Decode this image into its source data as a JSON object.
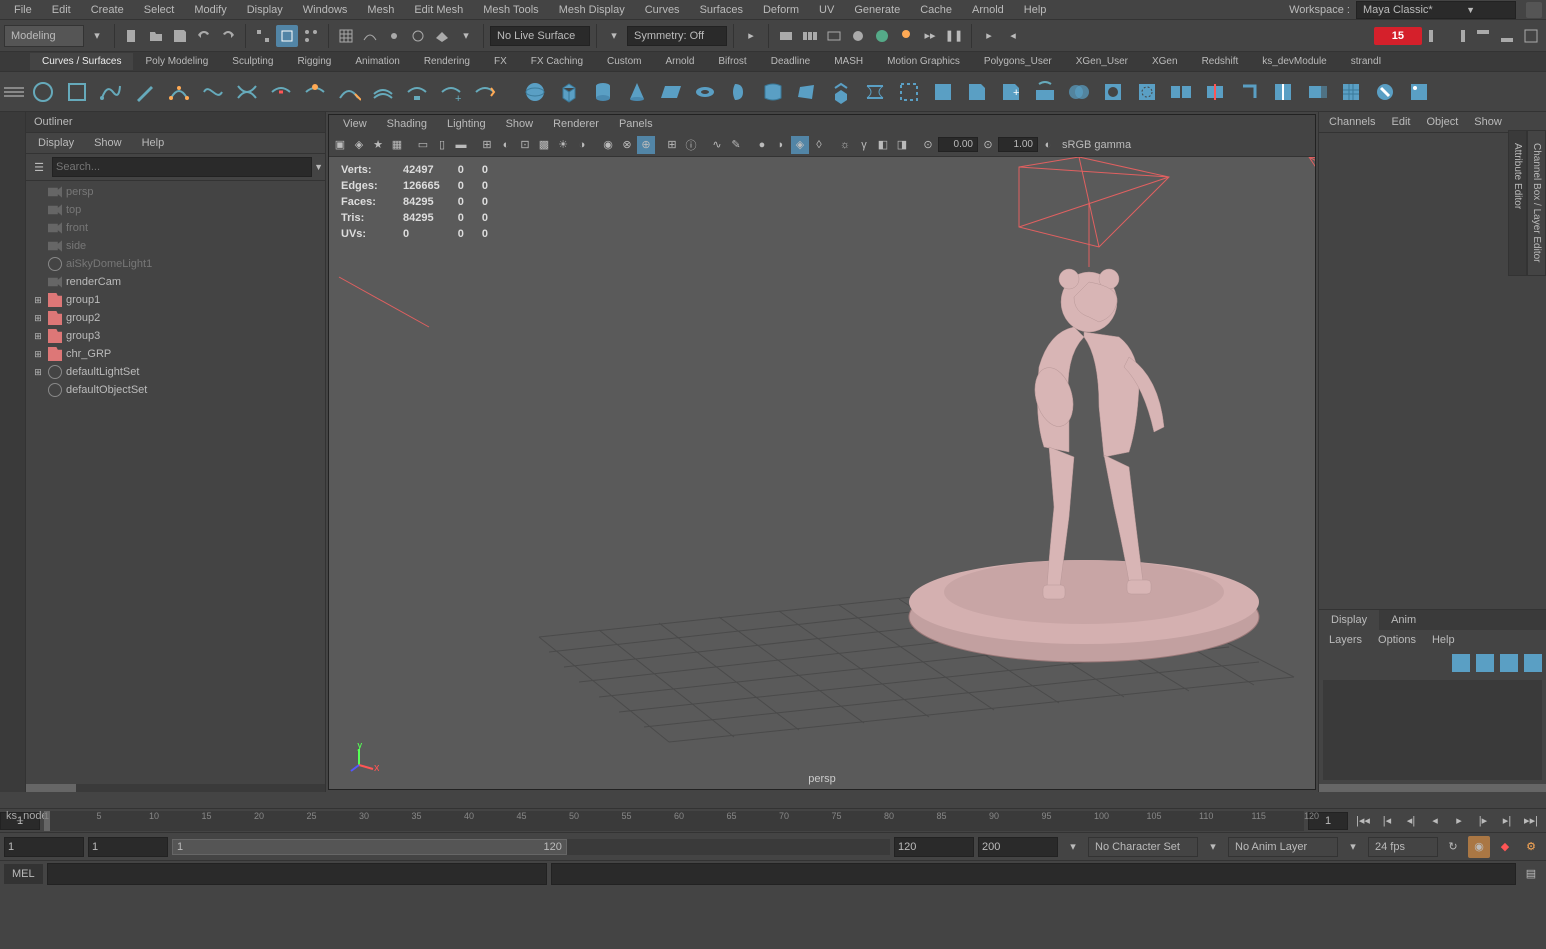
{
  "menubar": [
    "File",
    "Edit",
    "Create",
    "Select",
    "Modify",
    "Display",
    "Windows",
    "Mesh",
    "Edit Mesh",
    "Mesh Tools",
    "Mesh Display",
    "Curves",
    "Surfaces",
    "Deform",
    "UV",
    "Generate",
    "Cache",
    "Arnold",
    "Help"
  ],
  "workspace": {
    "label": "Workspace :",
    "value": "Maya Classic*"
  },
  "mode": "Modeling",
  "liveSurface": "No Live Surface",
  "symmetry": "Symmetry: Off",
  "frameCount": "15",
  "shelfTabs": [
    "Curves / Surfaces",
    "Poly Modeling",
    "Sculpting",
    "Rigging",
    "Animation",
    "Rendering",
    "FX",
    "FX Caching",
    "Custom",
    "Arnold",
    "Bifrost",
    "Deadline",
    "MASH",
    "Motion Graphics",
    "Polygons_User",
    "XGen_User",
    "XGen",
    "Redshift",
    "ks_devModule",
    "strandI"
  ],
  "activeShelfTab": 0,
  "outliner": {
    "title": "Outliner",
    "menu": [
      "Display",
      "Show",
      "Help"
    ],
    "searchPlaceholder": "Search...",
    "items": [
      {
        "type": "cam",
        "label": "persp",
        "dim": true
      },
      {
        "type": "cam",
        "label": "top",
        "dim": true
      },
      {
        "type": "cam",
        "label": "front",
        "dim": true
      },
      {
        "type": "cam",
        "label": "side",
        "dim": true
      },
      {
        "type": "light",
        "label": "aiSkyDomeLight1",
        "dim": true
      },
      {
        "type": "cam",
        "label": "renderCam"
      },
      {
        "type": "grp",
        "label": "group1",
        "exp": true
      },
      {
        "type": "grp",
        "label": "group2",
        "exp": true
      },
      {
        "type": "grp",
        "label": "group3",
        "exp": true
      },
      {
        "type": "grp",
        "label": "chr_GRP",
        "exp": true
      },
      {
        "type": "obj",
        "label": "defaultLightSet",
        "exp": true
      },
      {
        "type": "obj",
        "label": "defaultObjectSet"
      }
    ]
  },
  "viewport": {
    "menu": [
      "View",
      "Shading",
      "Lighting",
      "Show",
      "Renderer",
      "Panels"
    ],
    "near": "0.00",
    "far": "1.00",
    "gamma": "sRGB gamma",
    "hud": [
      [
        "Verts:",
        "42497",
        "0",
        "0"
      ],
      [
        "Edges:",
        "126665",
        "0",
        "0"
      ],
      [
        "Faces:",
        "84295",
        "0",
        "0"
      ],
      [
        "Tris:",
        "84295",
        "0",
        "0"
      ],
      [
        "UVs:",
        "0",
        "0",
        "0"
      ]
    ],
    "camera": "persp"
  },
  "channelBox": {
    "menu": [
      "Channels",
      "Edit",
      "Object",
      "Show"
    ]
  },
  "layers": {
    "tabs": [
      "Display",
      "Anim"
    ],
    "menu": [
      "Layers",
      "Options",
      "Help"
    ]
  },
  "timeline": {
    "ticks": [
      "1",
      "5",
      "10",
      "15",
      "20",
      "25",
      "30",
      "35",
      "40",
      "45",
      "50",
      "55",
      "60",
      "65",
      "70",
      "75",
      "80",
      "85",
      "90",
      "95",
      "100",
      "105",
      "110",
      "115",
      "120"
    ],
    "current": "1",
    "endField": "1"
  },
  "range": {
    "startOut": "1",
    "startIn": "1",
    "sliderVal": "1",
    "sliderEnd": "120",
    "endIn": "120",
    "endOut": "200",
    "charset": "No Character Set",
    "animLayer": "No Anim Layer",
    "fps": "24 fps"
  },
  "cmdline": {
    "label": "MEL"
  },
  "ksNode": "ks_nodeOutliner",
  "rightTabs": [
    "Channel Box / Layer Editor",
    "Attribute Editor"
  ]
}
